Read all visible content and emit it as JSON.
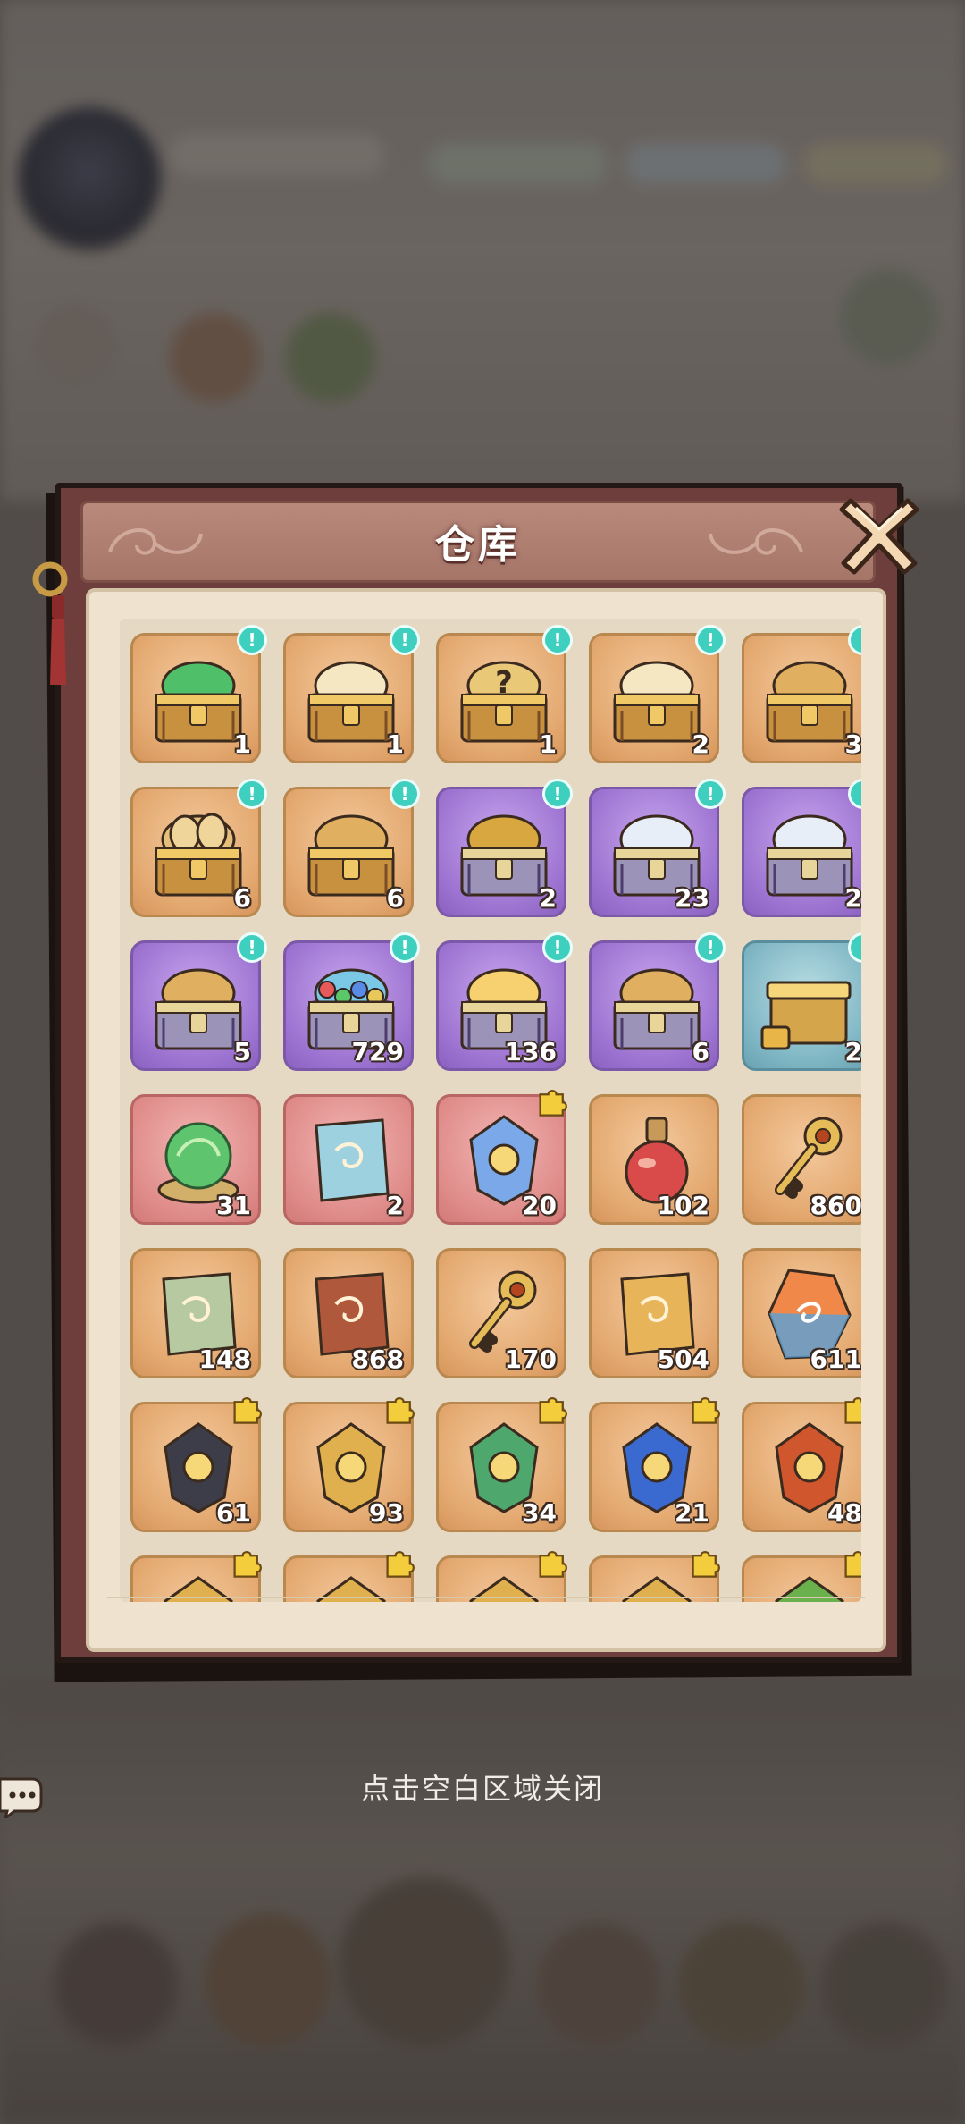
{
  "modal": {
    "title": "仓库"
  },
  "close_hint": "点击空白区域关闭",
  "colors": {
    "frame": "#6d3e3b",
    "panel": "#efe3d0",
    "rarity_orange": "#e3a86f",
    "rarity_purple": "#9d74d1",
    "rarity_blue": "#7fb6c4",
    "rarity_red": "#df8c8a",
    "new_badge": "#3fcfbf"
  },
  "items": [
    {
      "icon": "green-orb-chest-icon",
      "rarity": "orange",
      "qty": "1",
      "badge": "new"
    },
    {
      "icon": "leaf-card-chest-icon",
      "rarity": "orange",
      "qty": "1",
      "badge": "new"
    },
    {
      "icon": "mystery-card-chest-icon",
      "rarity": "orange",
      "qty": "1",
      "badge": "new"
    },
    {
      "icon": "leaf-card-chest-icon",
      "rarity": "orange",
      "qty": "2",
      "badge": "new"
    },
    {
      "icon": "puzzle-chest-icon",
      "rarity": "orange",
      "qty": "3",
      "badge": "new"
    },
    {
      "icon": "egg-chest-icon",
      "rarity": "orange",
      "qty": "6",
      "badge": "new"
    },
    {
      "icon": "heart-chest-icon",
      "rarity": "orange",
      "qty": "6",
      "badge": "new"
    },
    {
      "icon": "armor-chest-icon",
      "rarity": "purple",
      "qty": "2",
      "badge": "new"
    },
    {
      "icon": "card-chest-icon",
      "rarity": "purple",
      "qty": "23",
      "badge": "new"
    },
    {
      "icon": "card-chest-icon",
      "rarity": "purple",
      "qty": "2",
      "badge": "new"
    },
    {
      "icon": "puzzle-chest-icon",
      "rarity": "purple",
      "qty": "5",
      "badge": "new"
    },
    {
      "icon": "gem-chest-icon",
      "rarity": "purple",
      "qty": "729",
      "badge": "new"
    },
    {
      "icon": "flame-chest-icon",
      "rarity": "purple",
      "qty": "136",
      "badge": "new"
    },
    {
      "icon": "treasure-chest-icon",
      "rarity": "purple",
      "qty": "6",
      "badge": "new"
    },
    {
      "icon": "gold-box-icon",
      "rarity": "blue",
      "qty": "2",
      "badge": "new"
    },
    {
      "icon": "green-orb-icon",
      "rarity": "red",
      "qty": "31",
      "badge": ""
    },
    {
      "icon": "treasure-map-icon",
      "rarity": "red",
      "qty": "2",
      "badge": ""
    },
    {
      "icon": "crystal-altar-icon",
      "rarity": "red",
      "qty": "20",
      "badge": "piece"
    },
    {
      "icon": "potion-icon",
      "rarity": "orange",
      "qty": "102",
      "badge": ""
    },
    {
      "icon": "gold-key-icon",
      "rarity": "orange",
      "qty": "860",
      "badge": ""
    },
    {
      "icon": "spoon-card-icon",
      "rarity": "orange",
      "qty": "148",
      "badge": ""
    },
    {
      "icon": "scroll-ticket-icon",
      "rarity": "orange",
      "qty": "868",
      "badge": ""
    },
    {
      "icon": "ornate-key-icon",
      "rarity": "orange",
      "qty": "170",
      "badge": ""
    },
    {
      "icon": "rune-ticket-icon",
      "rarity": "orange",
      "qty": "504",
      "badge": ""
    },
    {
      "icon": "rainbow-stone-icon",
      "rarity": "orange",
      "qty": "611",
      "badge": ""
    },
    {
      "icon": "pagoda-lantern-icon",
      "rarity": "orange",
      "qty": "61",
      "badge": "piece"
    },
    {
      "icon": "golden-axe-icon",
      "rarity": "orange",
      "qty": "93",
      "badge": "piece"
    },
    {
      "icon": "jade-gauntlet-icon",
      "rarity": "orange",
      "qty": "34",
      "badge": "piece"
    },
    {
      "icon": "blue-orb-relic-icon",
      "rarity": "orange",
      "qty": "21",
      "badge": "piece"
    },
    {
      "icon": "fire-wheel-icon",
      "rarity": "orange",
      "qty": "48",
      "badge": "piece"
    },
    {
      "icon": "relic-fragment-icon",
      "rarity": "orange",
      "qty": "",
      "badge": "piece"
    },
    {
      "icon": "spear-tip-icon",
      "rarity": "orange",
      "qty": "",
      "badge": "piece"
    },
    {
      "icon": "orb-claw-icon",
      "rarity": "orange",
      "qty": "",
      "badge": "piece"
    },
    {
      "icon": "winged-relic-icon",
      "rarity": "orange",
      "qty": "",
      "badge": "piece"
    },
    {
      "icon": "bonsai-tree-icon",
      "rarity": "orange",
      "qty": "",
      "badge": "piece"
    }
  ]
}
